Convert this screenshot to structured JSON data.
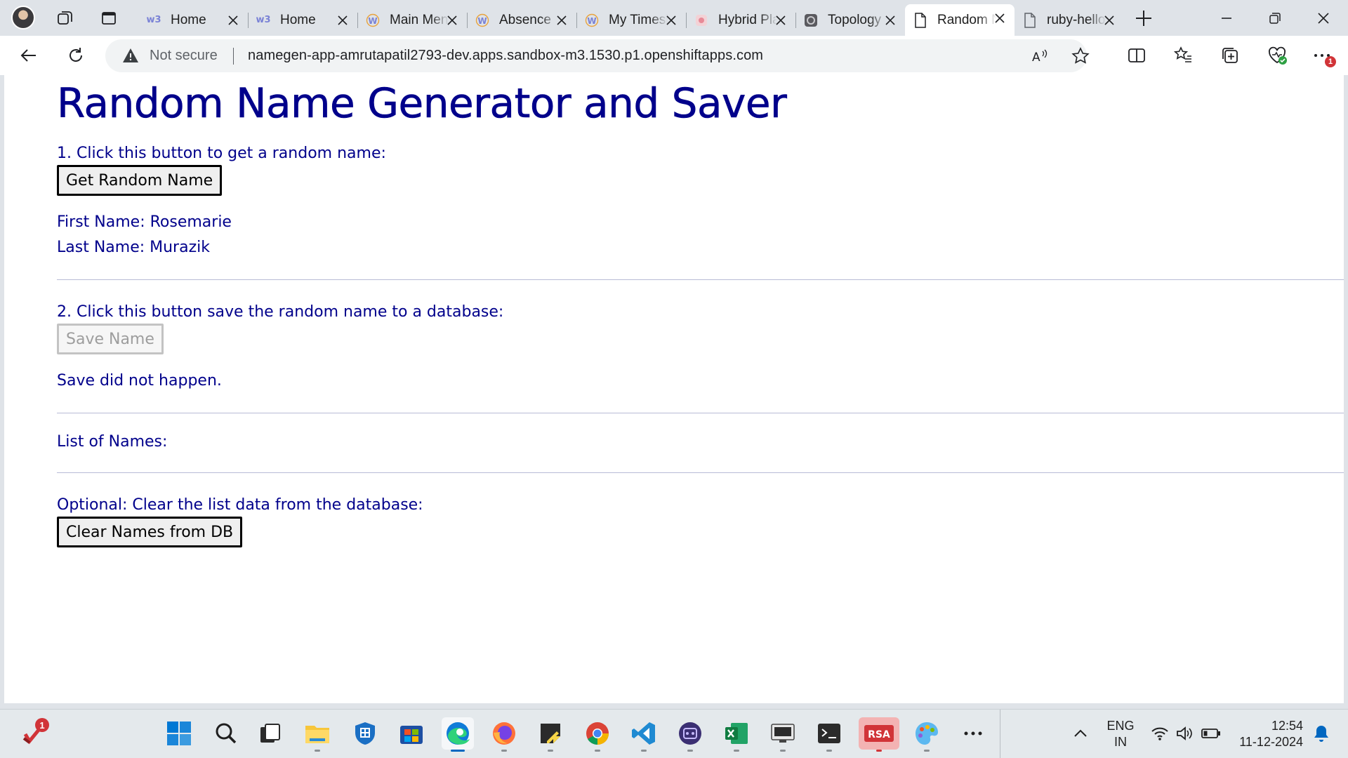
{
  "browser": {
    "tabs": [
      {
        "title": "Home",
        "favicon": "w3",
        "active": false
      },
      {
        "title": "Home",
        "favicon": "w3",
        "active": false
      },
      {
        "title": "Main Menu",
        "favicon": "w-wiki",
        "active": false
      },
      {
        "title": "Absence",
        "favicon": "w-wiki",
        "active": false
      },
      {
        "title": "My Timesheet",
        "favicon": "w-wiki",
        "active": false
      },
      {
        "title": "Hybrid Planner",
        "favicon": "hybrid-app",
        "active": false
      },
      {
        "title": "Topology",
        "favicon": "openshift",
        "active": false
      },
      {
        "title": "Random Name Generator",
        "favicon": "page",
        "active": true
      },
      {
        "title": "ruby-hello",
        "favicon": "page",
        "active": false
      }
    ],
    "address_bar": {
      "security_status": "Not secure",
      "url": "namegen-app-amrutapatil2793-dev.apps.sandbox-m3.1530.p1.openshiftapps.com"
    },
    "extensions_badge": "1"
  },
  "page": {
    "title": "Random Name Generator and Saver",
    "step1_label": "1. Click this button to get a random name:",
    "get_button": "Get Random Name",
    "first_name": "First Name: Rosemarie",
    "last_name": "Last Name: Murazik",
    "step2_label": "2. Click this button save the random name to a database:",
    "save_button": "Save Name",
    "save_status": "Save did not happen.",
    "list_label": "List of Names:",
    "optional_label": "Optional: Clear the list data from the database:",
    "clear_button": "Clear Names from DB"
  },
  "taskbar": {
    "notification_badge": "1",
    "language": "ENG",
    "region": "IN",
    "time": "12:54",
    "date": "11-12-2024",
    "apps": [
      "start",
      "search",
      "task-view",
      "file-explorer",
      "defender",
      "store",
      "edge",
      "firefox",
      "sticky-notes",
      "chrome",
      "vscode",
      "podman",
      "excel",
      "remote-desktop",
      "terminal",
      "rsa",
      "paint"
    ]
  },
  "colors": {
    "page_text": "#00008b",
    "tab_strip": "#dfe3e8",
    "taskbar": "#e4e9ec"
  }
}
